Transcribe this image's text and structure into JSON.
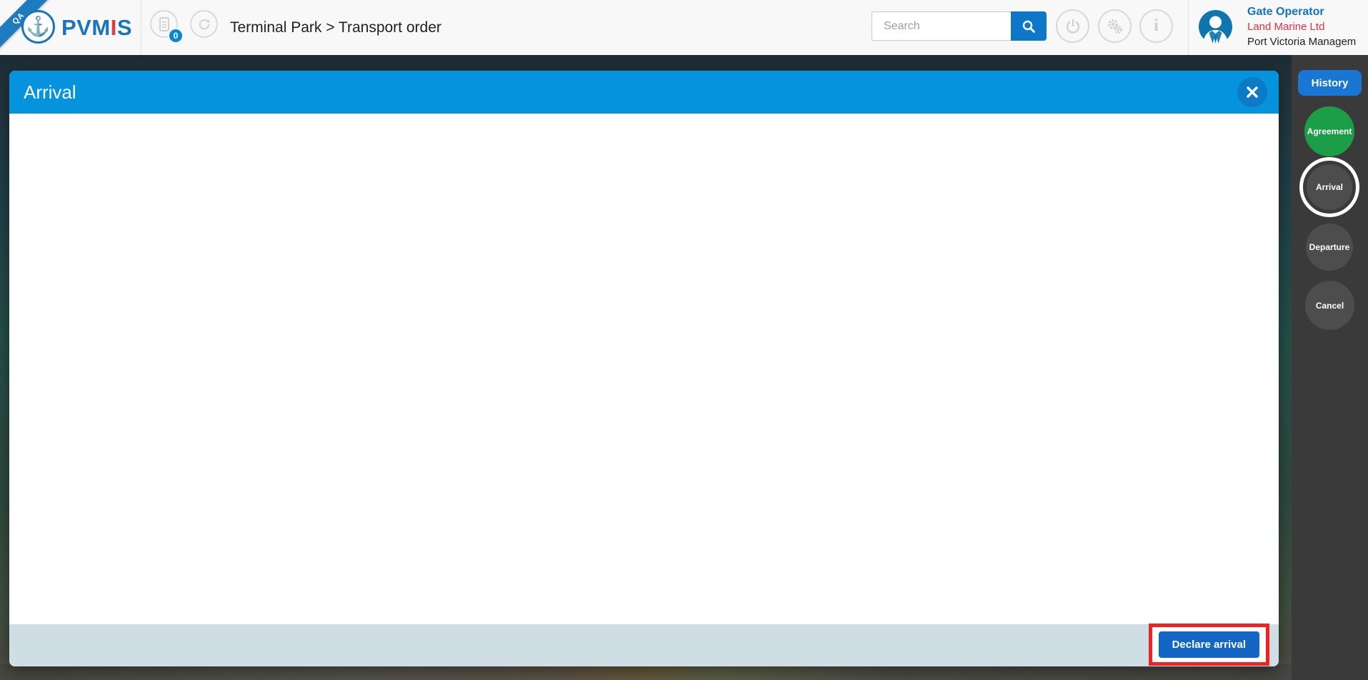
{
  "app": {
    "ribbon": "QA",
    "brand": {
      "prefix": "PVM",
      "mid": "I",
      "suffix": "S"
    }
  },
  "header": {
    "breadcrumb": "Terminal Park > Transport order",
    "badge_count": "0",
    "search": {
      "placeholder": "Search"
    },
    "user": {
      "role": "Gate Operator",
      "company": "Land Marine Ltd",
      "organization": "Port Victoria Managem"
    }
  },
  "modal": {
    "title": "Arrival",
    "footer": {
      "declare_arrival_label": "Declare arrival"
    }
  },
  "sidebar": {
    "history_label": "History",
    "steps": [
      {
        "label": "Agreement",
        "state": "completed"
      },
      {
        "label": "Arrival",
        "state": "active"
      },
      {
        "label": "Departure",
        "state": "pending"
      },
      {
        "label": "Cancel",
        "state": "pending"
      }
    ]
  },
  "glyphs": {
    "anchor": "⚓",
    "info": "i"
  },
  "colors": {
    "brand_blue": "#1b75bc",
    "brand_red": "#e03a3f",
    "modal_header_blue": "#0593de",
    "search_button_blue": "#0d78c9",
    "history_blue": "#1976d2",
    "declare_button_blue": "#1366c4",
    "agreement_green": "#1b9e47",
    "highlight_red": "#ee2424",
    "footer_gray": "#cfdde4",
    "sidebar_gray": "#3a3a3a",
    "role_text_blue": "#1273c2",
    "company_text_red": "#e32e44"
  }
}
